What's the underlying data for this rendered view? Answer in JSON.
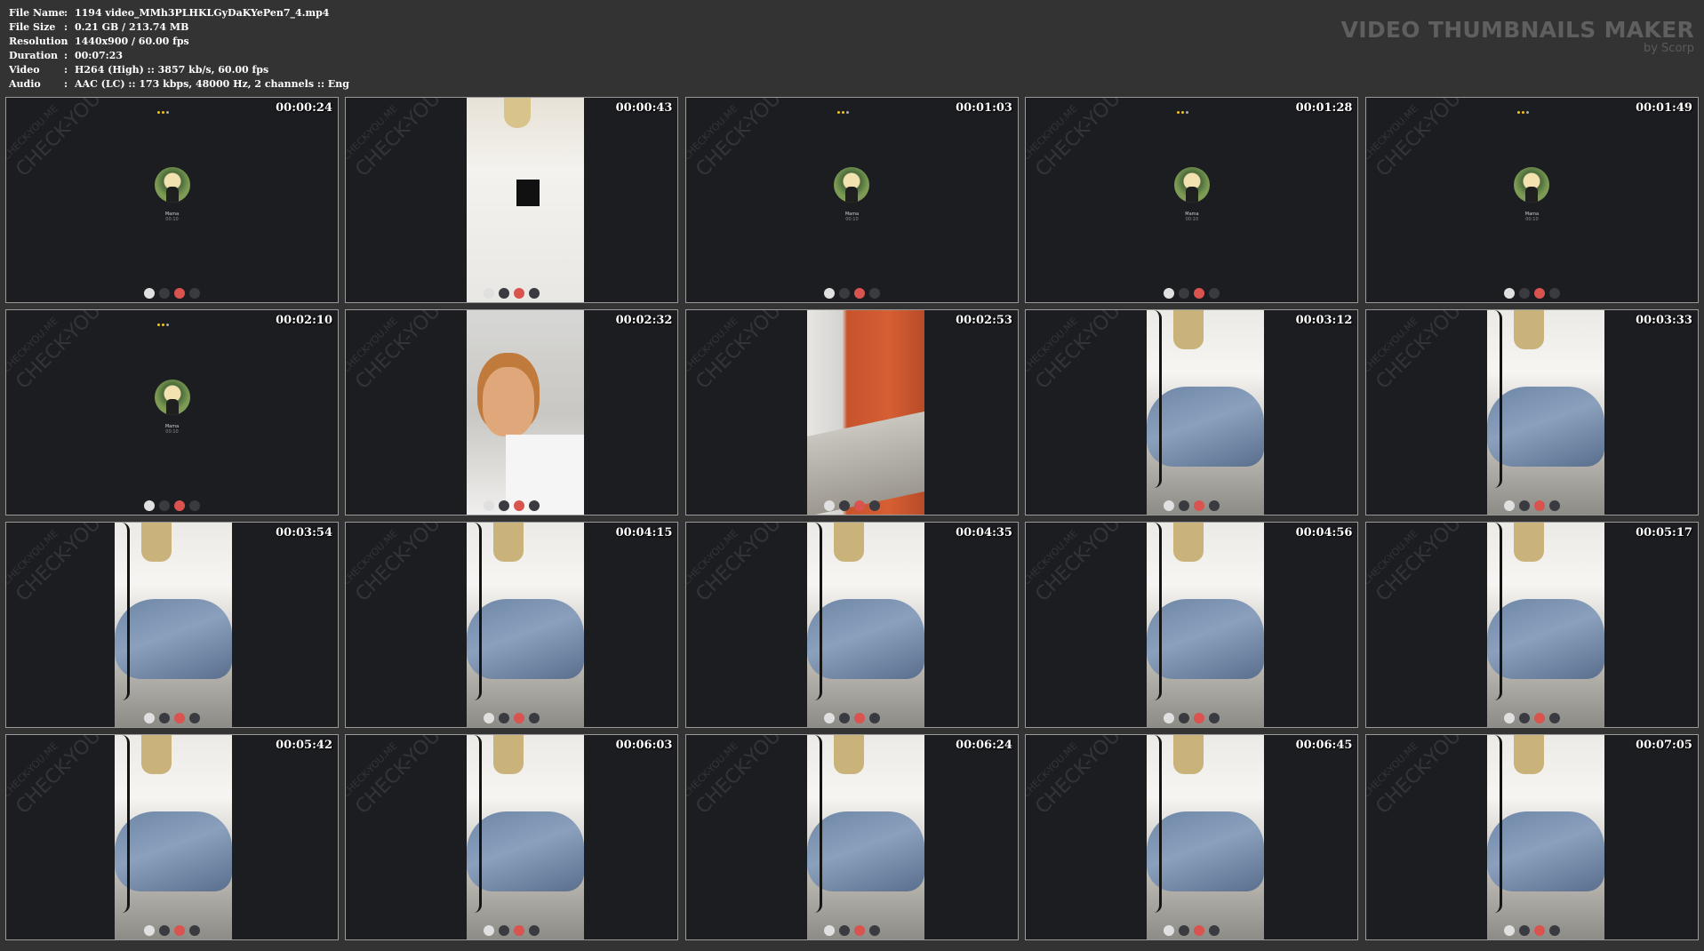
{
  "info": {
    "rows": [
      {
        "key": "File Name",
        "value": "1194 video_MMh3PLHKLGyDaKYePen7_4.mp4"
      },
      {
        "key": "File Size",
        "value": "0.21 GB  / 213.74 MB"
      },
      {
        "key": "Resolution",
        "value": "1440x900 / 60.00 fps"
      },
      {
        "key": "Duration",
        "value": "00:07:23"
      },
      {
        "key": "Video",
        "value": "H264 (High) :: 3857 kb/s, 60.00 fps"
      },
      {
        "key": "Audio",
        "value": "AAC (LC) :: 173 kbps, 48000 Hz, 2 channels :: Eng"
      }
    ],
    "separator": ":"
  },
  "brand": {
    "title": "VIDEO THUMBNAILS MAKER",
    "subtitle": "by Scorp"
  },
  "watermark": {
    "text": "CHECK-YOU.ME"
  },
  "call": {
    "name": "Mama",
    "status": "00:10"
  },
  "thumbnails": [
    {
      "time": "00:00:24",
      "scene": "call"
    },
    {
      "time": "00:00:43",
      "scene": "shirt"
    },
    {
      "time": "00:01:03",
      "scene": "call"
    },
    {
      "time": "00:01:28",
      "scene": "call"
    },
    {
      "time": "00:01:49",
      "scene": "call"
    },
    {
      "time": "00:02:10",
      "scene": "call"
    },
    {
      "time": "00:02:32",
      "scene": "face"
    },
    {
      "time": "00:02:53",
      "scene": "door"
    },
    {
      "time": "00:03:12",
      "scene": "squat"
    },
    {
      "time": "00:03:33",
      "scene": "squat"
    },
    {
      "time": "00:03:54",
      "scene": "squat"
    },
    {
      "time": "00:04:15",
      "scene": "squat"
    },
    {
      "time": "00:04:35",
      "scene": "squat"
    },
    {
      "time": "00:04:56",
      "scene": "squat"
    },
    {
      "time": "00:05:17",
      "scene": "squat"
    },
    {
      "time": "00:05:42",
      "scene": "squat"
    },
    {
      "time": "00:06:03",
      "scene": "squat"
    },
    {
      "time": "00:06:24",
      "scene": "squat"
    },
    {
      "time": "00:06:45",
      "scene": "squat"
    },
    {
      "time": "00:07:05",
      "scene": "squat"
    }
  ]
}
